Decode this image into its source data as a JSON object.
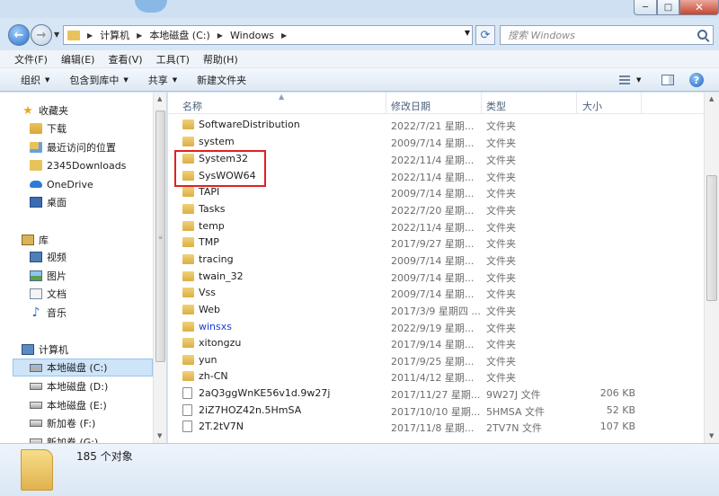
{
  "window": {
    "min_label": "─",
    "max_label": "□",
    "close_label": "✕"
  },
  "address": {
    "crumbs": [
      "计算机",
      "本地磁盘 (C:)",
      "Windows"
    ],
    "search_placeholder": "搜索 Windows"
  },
  "menu": [
    "文件(F)",
    "编辑(E)",
    "查看(V)",
    "工具(T)",
    "帮助(H)"
  ],
  "toolbar": {
    "organize": "组织",
    "include_in_library": "包含到库中",
    "share": "共享",
    "new_folder": "新建文件夹",
    "help": "?"
  },
  "nav": {
    "favorites": "收藏夹",
    "downloads": "下载",
    "recent": "最近访问的位置",
    "downloads2345": "2345Downloads",
    "onedrive": "OneDrive",
    "desktop": "桌面",
    "libraries": "库",
    "videos": "视频",
    "pictures": "图片",
    "documents": "文档",
    "music": "音乐",
    "computer": "计算机",
    "drive_c": "本地磁盘 (C:)",
    "drive_d": "本地磁盘 (D:)",
    "drive_e": "本地磁盘 (E:)",
    "drive_f": "新加卷 (F:)",
    "drive_g": "新加卷 (G:)"
  },
  "columns": {
    "name": "名称",
    "date": "修改日期",
    "type": "类型",
    "size": "大小"
  },
  "files": [
    {
      "name": "SoftwareDistribution",
      "date": "2022/7/21 星期...",
      "type": "文件夹",
      "size": ""
    },
    {
      "name": "system",
      "date": "2009/7/14 星期...",
      "type": "文件夹",
      "size": ""
    },
    {
      "name": "System32",
      "date": "2022/11/4 星期...",
      "type": "文件夹",
      "size": ""
    },
    {
      "name": "SysWOW64",
      "date": "2022/11/4 星期...",
      "type": "文件夹",
      "size": ""
    },
    {
      "name": "TAPI",
      "date": "2009/7/14 星期...",
      "type": "文件夹",
      "size": ""
    },
    {
      "name": "Tasks",
      "date": "2022/7/20 星期...",
      "type": "文件夹",
      "size": ""
    },
    {
      "name": "temp",
      "date": "2022/11/4 星期...",
      "type": "文件夹",
      "size": ""
    },
    {
      "name": "TMP",
      "date": "2017/9/27 星期...",
      "type": "文件夹",
      "size": ""
    },
    {
      "name": "tracing",
      "date": "2009/7/14 星期...",
      "type": "文件夹",
      "size": ""
    },
    {
      "name": "twain_32",
      "date": "2009/7/14 星期...",
      "type": "文件夹",
      "size": ""
    },
    {
      "name": "Vss",
      "date": "2009/7/14 星期...",
      "type": "文件夹",
      "size": ""
    },
    {
      "name": "Web",
      "date": "2017/3/9 星期四 ...",
      "type": "文件夹",
      "size": ""
    },
    {
      "name": "winsxs",
      "date": "2022/9/19 星期...",
      "type": "文件夹",
      "size": ""
    },
    {
      "name": "xitongzu",
      "date": "2017/9/14 星期...",
      "type": "文件夹",
      "size": ""
    },
    {
      "name": "yun",
      "date": "2017/9/25 星期...",
      "type": "文件夹",
      "size": ""
    },
    {
      "name": "zh-CN",
      "date": "2011/4/12 星期...",
      "type": "文件夹",
      "size": ""
    },
    {
      "name": "2aQ3ggWnKE56v1d.9w27j",
      "date": "2017/11/27 星期...",
      "type": "9W27J 文件",
      "size": "206 KB"
    },
    {
      "name": "2iZ7HOZ42n.5HmSA",
      "date": "2017/10/10 星期...",
      "type": "5HMSA 文件",
      "size": "52 KB"
    },
    {
      "name": "2T.2tV7N",
      "date": "2017/11/8 星期...",
      "type": "2TV7N 文件",
      "size": "107 KB"
    }
  ],
  "status": {
    "count": "185 个对象"
  }
}
